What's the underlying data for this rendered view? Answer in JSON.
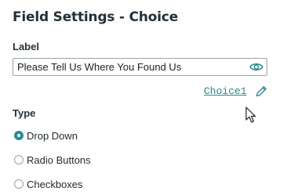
{
  "panel": {
    "title": "Field Settings - Choice"
  },
  "label_field": {
    "label": "Label",
    "value": "Please Tell Us Where You Found Us",
    "visibility_icon": "eye-icon"
  },
  "choice_link": {
    "text": "Choice1",
    "edit_icon": "pencil-icon"
  },
  "type_group": {
    "label": "Type",
    "options": [
      {
        "label": "Drop Down",
        "selected": true
      },
      {
        "label": "Radio Buttons",
        "selected": false
      },
      {
        "label": "Checkboxes",
        "selected": false
      }
    ]
  },
  "colors": {
    "accent": "#2a8a92",
    "text": "#22313a",
    "border": "#9aa3a8"
  }
}
